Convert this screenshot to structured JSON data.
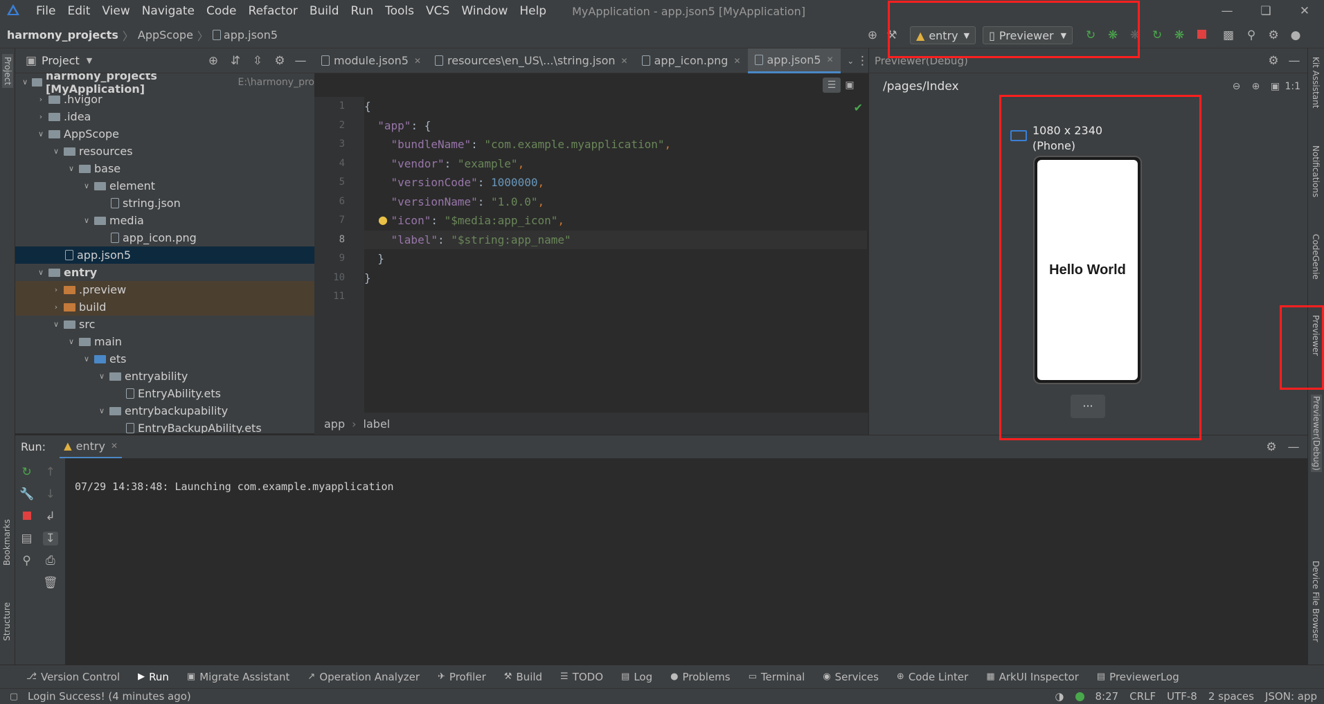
{
  "menubar": {
    "menus": [
      "File",
      "Edit",
      "View",
      "Navigate",
      "Code",
      "Refactor",
      "Build",
      "Run",
      "Tools",
      "VCS",
      "Window",
      "Help"
    ],
    "window_title": "MyApplication - app.json5 [MyApplication]"
  },
  "navbar": {
    "breadcrumb": [
      "harmony_projects",
      "AppScope",
      "app.json5"
    ],
    "run_config": "entry",
    "device_selector": "Previewer"
  },
  "project_panel": {
    "title": "Project",
    "tree": [
      {
        "label": "harmony_projects [MyApplication]",
        "extra": "E:\\harmony_pro",
        "depth": 0,
        "type": "root",
        "open": true
      },
      {
        "label": ".hvigor",
        "depth": 1,
        "type": "folder",
        "open": false
      },
      {
        "label": ".idea",
        "depth": 1,
        "type": "folder",
        "open": false
      },
      {
        "label": "AppScope",
        "depth": 1,
        "type": "folder",
        "open": true
      },
      {
        "label": "resources",
        "depth": 2,
        "type": "folder",
        "open": true
      },
      {
        "label": "base",
        "depth": 3,
        "type": "folder",
        "open": true
      },
      {
        "label": "element",
        "depth": 4,
        "type": "folder",
        "open": true
      },
      {
        "label": "string.json",
        "depth": 5,
        "type": "file"
      },
      {
        "label": "media",
        "depth": 4,
        "type": "folder",
        "open": true
      },
      {
        "label": "app_icon.png",
        "depth": 5,
        "type": "file"
      },
      {
        "label": "app.json5",
        "depth": 2,
        "type": "file",
        "selected": true
      },
      {
        "label": "entry",
        "depth": 1,
        "type": "module",
        "open": true
      },
      {
        "label": ".preview",
        "depth": 2,
        "type": "orange",
        "open": false,
        "excluded": true
      },
      {
        "label": "build",
        "depth": 2,
        "type": "orange",
        "open": false,
        "excluded": true
      },
      {
        "label": "src",
        "depth": 2,
        "type": "folder",
        "open": true
      },
      {
        "label": "main",
        "depth": 3,
        "type": "folder",
        "open": true
      },
      {
        "label": "ets",
        "depth": 4,
        "type": "blue",
        "open": true
      },
      {
        "label": "entryability",
        "depth": 5,
        "type": "folder",
        "open": true
      },
      {
        "label": "EntryAbility.ets",
        "depth": 6,
        "type": "file"
      },
      {
        "label": "entrybackupability",
        "depth": 5,
        "type": "folder",
        "open": true
      },
      {
        "label": "EntryBackupAbility.ets",
        "depth": 6,
        "type": "file"
      }
    ]
  },
  "editor": {
    "tabs": [
      {
        "label": "module.json5",
        "active": false
      },
      {
        "label": "resources\\en_US\\...\\string.json",
        "active": false
      },
      {
        "label": "app_icon.png",
        "active": false
      },
      {
        "label": "app.json5",
        "active": true
      }
    ],
    "lines": [
      {
        "n": "1",
        "parts": [
          {
            "c": "w",
            "t": "{"
          }
        ]
      },
      {
        "n": "2",
        "parts": [
          {
            "c": "w",
            "t": "  "
          },
          {
            "c": "k",
            "t": "\"app\""
          },
          {
            "c": "w",
            "t": ": {"
          }
        ]
      },
      {
        "n": "3",
        "parts": [
          {
            "c": "w",
            "t": "    "
          },
          {
            "c": "k",
            "t": "\"bundleName\""
          },
          {
            "c": "w",
            "t": ": "
          },
          {
            "c": "s",
            "t": "\"com.example.myapplication\""
          },
          {
            "c": "p",
            "t": ","
          }
        ]
      },
      {
        "n": "4",
        "parts": [
          {
            "c": "w",
            "t": "    "
          },
          {
            "c": "k",
            "t": "\"vendor\""
          },
          {
            "c": "w",
            "t": ": "
          },
          {
            "c": "s",
            "t": "\"example\""
          },
          {
            "c": "p",
            "t": ","
          }
        ]
      },
      {
        "n": "5",
        "parts": [
          {
            "c": "w",
            "t": "    "
          },
          {
            "c": "k",
            "t": "\"versionCode\""
          },
          {
            "c": "w",
            "t": ": "
          },
          {
            "c": "n",
            "t": "1000000"
          },
          {
            "c": "p",
            "t": ","
          }
        ]
      },
      {
        "n": "6",
        "parts": [
          {
            "c": "w",
            "t": "    "
          },
          {
            "c": "k",
            "t": "\"versionName\""
          },
          {
            "c": "w",
            "t": ": "
          },
          {
            "c": "s",
            "t": "\"1.0.0\""
          },
          {
            "c": "p",
            "t": ","
          }
        ]
      },
      {
        "n": "7",
        "parts": [
          {
            "c": "w",
            "t": "    "
          },
          {
            "c": "k",
            "t": "\"icon\""
          },
          {
            "c": "w",
            "t": ": "
          },
          {
            "c": "s",
            "t": "\"$media:app_icon\""
          },
          {
            "c": "p",
            "t": ","
          }
        ]
      },
      {
        "n": "8",
        "parts": [
          {
            "c": "w",
            "t": "    "
          },
          {
            "c": "k",
            "t": "\"label\""
          },
          {
            "c": "w",
            "t": ": "
          },
          {
            "c": "s",
            "t": "\"$string:app_name\""
          }
        ]
      },
      {
        "n": "9",
        "parts": [
          {
            "c": "w",
            "t": "  }"
          }
        ]
      },
      {
        "n": "10",
        "parts": [
          {
            "c": "w",
            "t": "}"
          }
        ]
      },
      {
        "n": "11",
        "parts": []
      }
    ],
    "current_line": "8",
    "breadcrumbs": [
      "app",
      "label"
    ]
  },
  "previewer": {
    "title": "Previewer(Debug)",
    "page": "/pages/Index",
    "device_line1": "1080 x 2340",
    "device_line2": "(Phone)",
    "screen_text": "Hello World",
    "more": "···",
    "zoom_label": "1:1"
  },
  "right_strip": [
    "Kit Assistant",
    "Notifications",
    "CodeGenie",
    "Previewer",
    "Previewer(Debug)",
    "Device File Browser"
  ],
  "left_strip": [
    "Project",
    "Bookmarks",
    "Structure"
  ],
  "run_panel": {
    "label": "Run:",
    "tab": "entry",
    "console_line": "07/29 14:38:48: Launching com.example.myapplication"
  },
  "tool_windows": [
    "Version Control",
    "Run",
    "Migrate Assistant",
    "Operation Analyzer",
    "Profiler",
    "Build",
    "TODO",
    "Log",
    "Problems",
    "Terminal",
    "Services",
    "Code Linter",
    "ArkUI Inspector",
    "PreviewerLog"
  ],
  "status": {
    "message": "Login Success! (4 minutes ago)",
    "position": "8:27",
    "line_sep": "CRLF",
    "encoding": "UTF-8",
    "indent": "2 spaces",
    "schema": "JSON: app"
  },
  "colors": {
    "accent": "#4a88c7",
    "highlight": "#ff1f1f",
    "selection": "#0d293e"
  }
}
